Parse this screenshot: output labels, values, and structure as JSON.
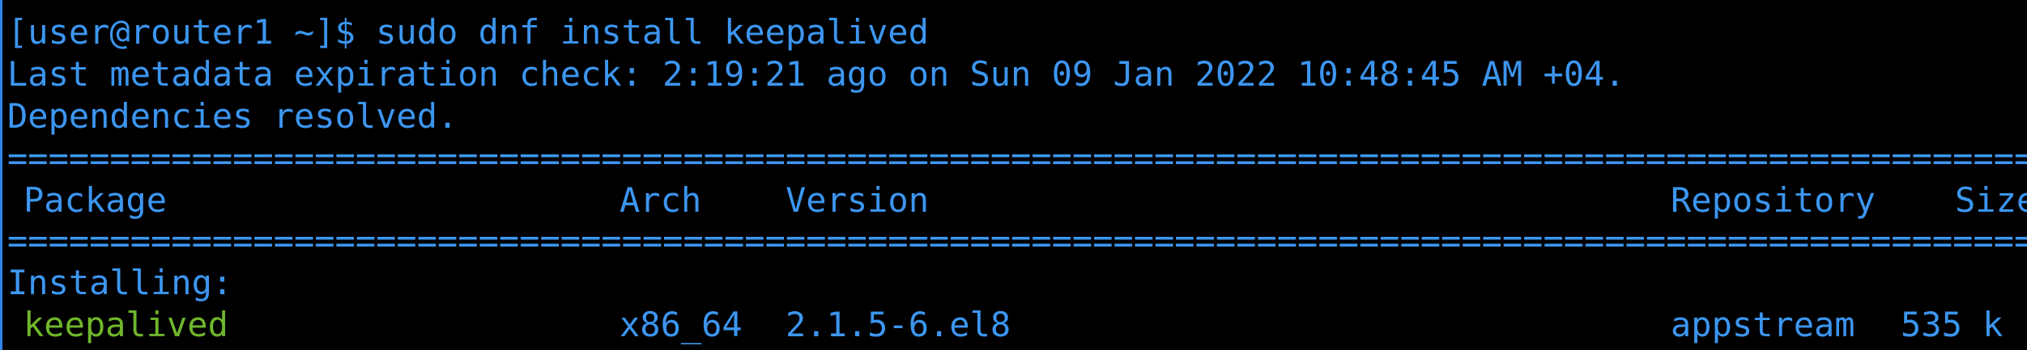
{
  "terminal": {
    "prompt_command": "[user@router1 ~]$ sudo dnf install keepalived",
    "metadata_line": "Last metadata expiration check: 2:19:21 ago on Sun 09 Jan 2022 10:48:45 AM +04.",
    "deps_line": "Dependencies resolved.",
    "separator": "=======================================================================================================================================",
    "table": {
      "headers": {
        "package": "Package",
        "arch": "Arch",
        "version": "Version",
        "repository": "Repository",
        "size": "Size"
      },
      "section_label": "Installing:",
      "rows": [
        {
          "package": "keepalived",
          "arch": "x86_64",
          "version": "2.1.5-6.el8",
          "repository": "appstream",
          "size": "535 k"
        }
      ]
    },
    "colors": {
      "background": "#000000",
      "text": "#3c96f0",
      "package_name": "#6fb72b",
      "border": "#2f86e8"
    }
  }
}
